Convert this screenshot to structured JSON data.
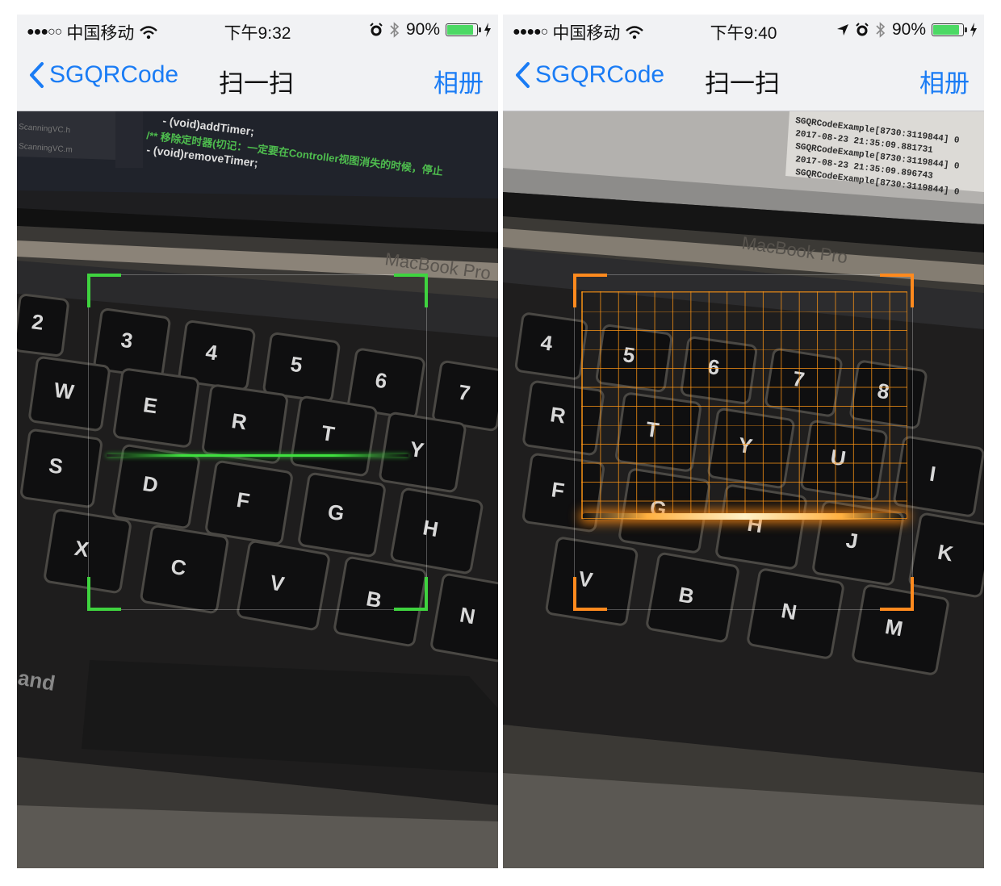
{
  "screens": [
    {
      "status": {
        "signal": "●●●○○",
        "carrier": "中国移动",
        "time": "下午9:32",
        "battery_percent": "90%",
        "battery_level": 0.9
      },
      "nav": {
        "back_label": "SGQRCode",
        "title": "扫一扫",
        "right_label": "相册"
      },
      "scanner": {
        "style": "green-line",
        "accent_color": "#3fd33f"
      },
      "photo": {
        "keys": [
          "2",
          "3",
          "4",
          "5",
          "6",
          "7",
          "W",
          "E",
          "R",
          "T",
          "Y",
          "S",
          "D",
          "F",
          "G",
          "H",
          "X",
          "C",
          "V",
          "B",
          "N"
        ],
        "code_lines": [
          "- (void)addTimer;",
          "/** 移除定时器(切记：一定要在Controller视图消失的时候，停止",
          "- (void)removeTimer;"
        ],
        "files": [
          "ScanningVC.h",
          "ScanningVC.m"
        ],
        "brand": "MacBook Pro",
        "misc": "and"
      }
    },
    {
      "status": {
        "signal": "●●●●○",
        "carrier": "中国移动",
        "time": "下午9:40",
        "battery_percent": "90%",
        "battery_level": 0.9
      },
      "nav": {
        "back_label": "SGQRCode",
        "title": "扫一扫",
        "right_label": "相册"
      },
      "scanner": {
        "style": "orange-grid",
        "accent_color": "#ff8a1e"
      },
      "photo": {
        "keys": [
          "4",
          "5",
          "6",
          "7",
          "8",
          "R",
          "T",
          "Y",
          "U",
          "I",
          "F",
          "G",
          "H",
          "J",
          "K",
          "V",
          "B",
          "N",
          "M"
        ],
        "log_lines": [
          "SGQRCodeExample[8730:3119844] 0",
          "2017-08-23 21:35:09.881731",
          "SGQRCodeExample[8730:3119844] 0",
          "2017-08-23 21:35:09.896743",
          "SGQRCodeExample[8730:3119844] 0"
        ],
        "brand": "MacBook Pro"
      }
    }
  ]
}
